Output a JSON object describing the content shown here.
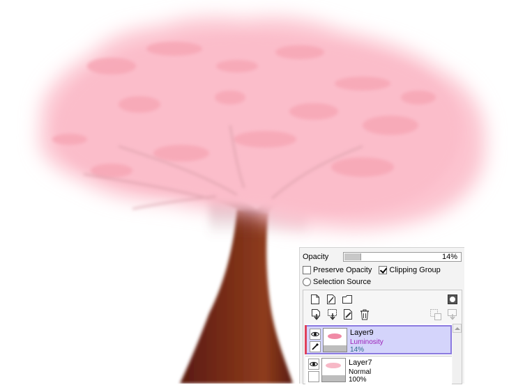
{
  "panel": {
    "opacity_label": "Opacity",
    "opacity_value": "14%",
    "opacity_fraction": 0.14,
    "preserve_opacity_label": "Preserve Opacity",
    "preserve_opacity_checked": false,
    "clipping_group_label": "Clipping Group",
    "clipping_group_checked": true,
    "selection_source_label": "Selection Source",
    "selection_source_selected": false
  },
  "toolbar": {
    "icons": [
      "new-layer-icon",
      "new-linework-layer-icon",
      "new-folder-icon",
      "layer-mask-icon",
      "transfer-down-icon",
      "merge-down-icon",
      "clear-layer-icon",
      "delete-layer-icon",
      "transfer-selection-icon",
      "merge-selection-icon"
    ]
  },
  "layers": [
    {
      "name": "Layer9",
      "mode": "Luminosity",
      "opacity": "14%",
      "selected": true,
      "clipped": true,
      "mode_color": "#9b1fb8",
      "opacity_color": "#2d6c8a"
    },
    {
      "name": "Layer7",
      "mode": "Normal",
      "opacity": "100%",
      "selected": false,
      "clipped": false,
      "mode_color": "#000000",
      "opacity_color": "#000000"
    }
  ],
  "colors": {
    "blossom": "#fcc0cc",
    "blossom_shadow": "#f8a6b4",
    "trunk": "#6b2414",
    "selected_layer_bg": "#d4d4fb",
    "selected_layer_border": "#8b7ae0"
  }
}
